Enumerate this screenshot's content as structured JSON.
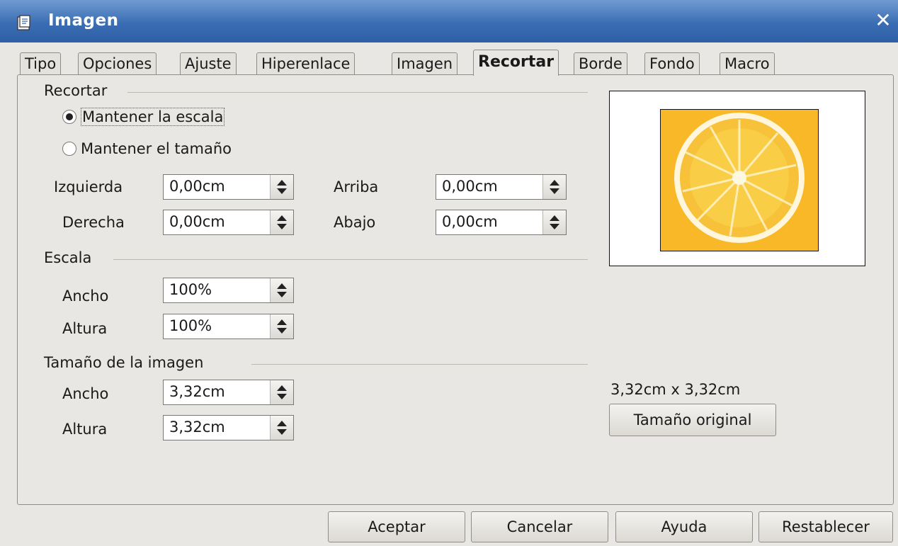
{
  "window": {
    "title": "Imagen",
    "close_glyph": "✕"
  },
  "tabs": [
    {
      "label": "Tipo"
    },
    {
      "label": "Opciones"
    },
    {
      "label": "Ajuste"
    },
    {
      "label": "Hiperenlace"
    },
    {
      "label": "Imagen"
    },
    {
      "label": "Recortar",
      "active": true
    },
    {
      "label": "Borde"
    },
    {
      "label": "Fondo"
    },
    {
      "label": "Macro"
    }
  ],
  "crop": {
    "section_label": "Recortar",
    "keep_scale_label": "Mantener la escala",
    "keep_size_label": "Mantener el tamaño",
    "keep_scale_selected": true,
    "left_label": "Izquierda",
    "left_value": "0,00cm",
    "right_label": "Derecha",
    "right_value": "0,00cm",
    "top_label": "Arriba",
    "top_value": "0,00cm",
    "bottom_label": "Abajo",
    "bottom_value": "0,00cm"
  },
  "scale": {
    "section_label": "Escala",
    "width_label": "Ancho",
    "width_value": "100%",
    "height_label": "Altura",
    "height_value": "100%"
  },
  "image_size": {
    "section_label": "Tamaño de la imagen",
    "width_label": "Ancho",
    "width_value": "3,32cm",
    "height_label": "Altura",
    "height_value": "3,32cm"
  },
  "preview": {
    "size_text": "3,32cm x 3,32cm",
    "original_size_button": "Tamaño original"
  },
  "buttons": {
    "ok": "Aceptar",
    "cancel": "Cancelar",
    "help": "Ayuda",
    "reset": "Restablecer"
  },
  "icons": {
    "app": "document-icon",
    "close": "close-icon",
    "spin": "spin-up-down-icon"
  },
  "colors": {
    "titlebar": "#3a6db3",
    "orange": "#f8b828",
    "background": "#e9e7e3"
  }
}
